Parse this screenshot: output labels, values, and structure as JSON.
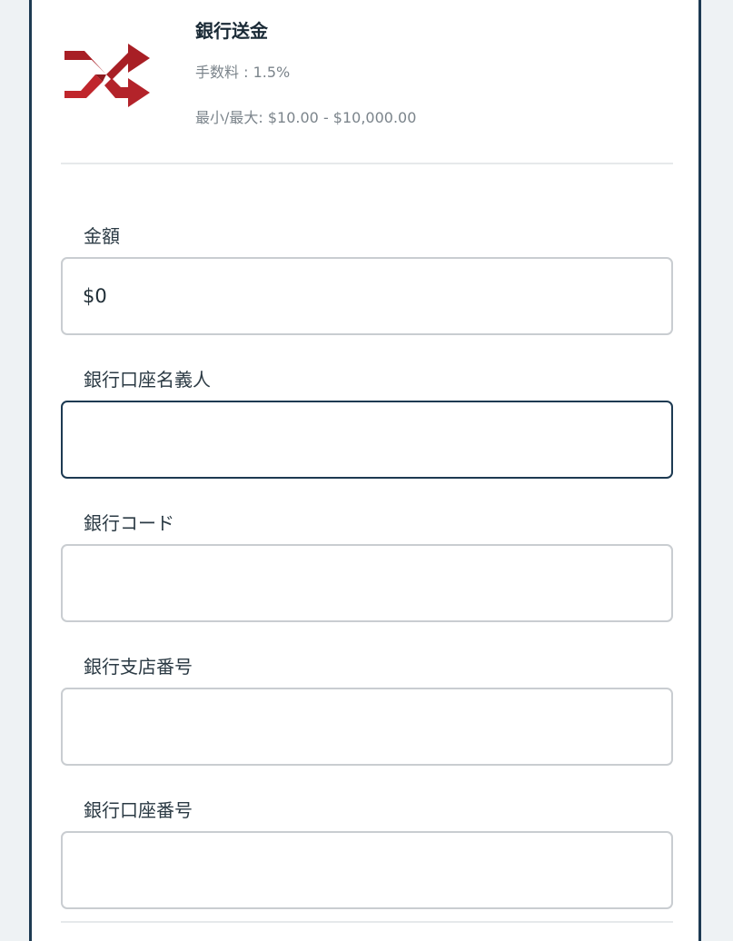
{
  "method": {
    "icon": "shuffle-icon",
    "title": "銀行送金",
    "fee": "手数料 : 1.5%",
    "limits": "最小/最大: $10.00 - $10,000.00"
  },
  "form": {
    "amount": {
      "label": "金額",
      "value": "$0"
    },
    "account_holder": {
      "label": "銀行口座名義人",
      "value": ""
    },
    "bank_code": {
      "label": "銀行コード",
      "value": ""
    },
    "branch_number": {
      "label": "銀行支店番号",
      "value": ""
    },
    "account_number": {
      "label": "銀行口座番号",
      "value": ""
    }
  },
  "colors": {
    "accent": "#1d3a52",
    "icon_red": "#c0262c"
  }
}
